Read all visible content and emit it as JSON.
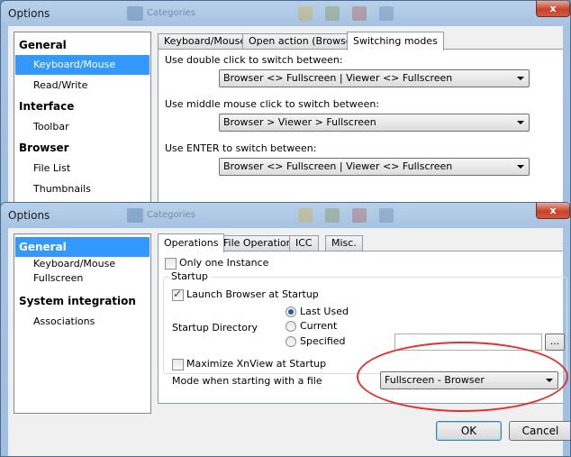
{
  "window1": {
    "title": "Options",
    "close_label": "x",
    "sidebar": [
      {
        "label": "General",
        "type": "header"
      },
      {
        "label": "Keyboard/Mouse",
        "type": "item",
        "selected": true
      },
      {
        "label": "Read/Write",
        "type": "item"
      },
      {
        "label": "Interface",
        "type": "header"
      },
      {
        "label": "Toolbar",
        "type": "item"
      },
      {
        "label": "Browser",
        "type": "header"
      },
      {
        "label": "File List",
        "type": "item"
      },
      {
        "label": "Thumbnails",
        "type": "item"
      }
    ],
    "tabs": [
      "Keyboard/Mouse",
      "Open action (Browser)",
      "Switching modes"
    ],
    "active_tab": "Switching modes",
    "double_click_label": "Use double click to switch between:",
    "double_click_value": "Browser <> Fullscreen | Viewer <> Fullscreen",
    "middle_click_label": "Use middle mouse click to switch between:",
    "middle_click_value": "Browser > Viewer > Fullscreen",
    "enter_label": "Use ENTER to switch between:",
    "enter_value": "Browser <> Fullscreen | Viewer <> Fullscreen"
  },
  "window2": {
    "title": "Options",
    "close_label": "x",
    "sidebar": [
      {
        "label": "General",
        "type": "header",
        "selected": true
      },
      {
        "label": "Keyboard/Mouse",
        "type": "item"
      },
      {
        "label": "Fullscreen",
        "type": "item"
      },
      {
        "label": "System integration",
        "type": "header"
      },
      {
        "label": "Associations",
        "type": "item"
      }
    ],
    "tabs": [
      "Operations",
      "File Operations",
      "ICC",
      "Misc."
    ],
    "active_tab": "Operations",
    "only_one_instance": {
      "label": "Only one Instance",
      "checked": false
    },
    "startup_group": "Startup",
    "launch_browser": {
      "label": "Launch Browser at Startup",
      "checked": true
    },
    "startup_directory_label": "Startup Directory",
    "startup_options": [
      {
        "label": "Last Used",
        "selected": true
      },
      {
        "label": "Current",
        "selected": false
      },
      {
        "label": "Specified",
        "selected": false
      }
    ],
    "specified_value": "",
    "browse_label": "...",
    "maximize": {
      "label": "Maximize XnView at Startup",
      "checked": false
    },
    "mode_label": "Mode when starting with a file",
    "mode_value": "Fullscreen - Browser",
    "ok_label": "OK",
    "cancel_label": "Cancel"
  },
  "background_taskbar": {
    "item1": "Categories",
    "item2": "Categories"
  },
  "colors": {
    "selection": "#3399ff",
    "highlight_ellipse": "#e0322e",
    "close_button": "#c7432b"
  }
}
